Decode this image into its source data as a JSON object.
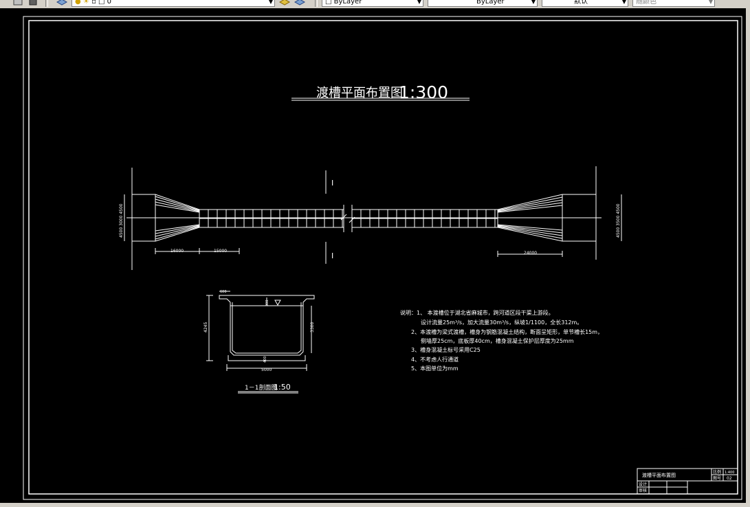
{
  "toolbar": {
    "layer_value": "0",
    "color_value": "ByLayer",
    "linetype_value": "ByLayer",
    "lineweight_value": "默认",
    "plotstyle_value": "随颜色"
  },
  "drawing": {
    "title": "渡槽平面布置图",
    "title_scale": "1:300",
    "section_mark": "I",
    "dim_left_vert": "4500 3000 4500",
    "dim_right_vert": "4500 3500 4500",
    "dim_16000": "16000",
    "dim_15000": "15000",
    "dim_24000": "24000",
    "section_title": "1－1剖面图",
    "section_scale": "1:50",
    "sec_dim_top": "600",
    "sec_dim_left": "4245",
    "sec_dim_right": "3300",
    "sec_dim_center": "300",
    "sec_dim_bottom_inner": "400",
    "sec_dim_width": "5000"
  },
  "notes": {
    "line1": "说明：1、 本渡槽位于湖北省麻城市，跨河道区段干渠上游段。",
    "line2": "设计流量25m³/s，加大流量30m³/s，纵坡1/1100，全长312m。",
    "line3": "2、本渡槽为梁式渡槽，槽身为钢筋混凝土结构，断面呈矩形，单节槽长15m，",
    "line4": "侧墙厚25cm，底板厚40cm，槽身混凝土保护层厚度为25mm",
    "line5": "3、槽身混凝土标号采用C25",
    "line6": "4、不考虑人行通道",
    "line7": "5、本图单位为mm"
  },
  "title_block": {
    "drawing_name": "渡槽平面布置图",
    "label_scale": "比例",
    "scale_value": "1:400",
    "label_no": "图号",
    "no_value": "02",
    "label_design": "设计",
    "label_check": "审核"
  }
}
